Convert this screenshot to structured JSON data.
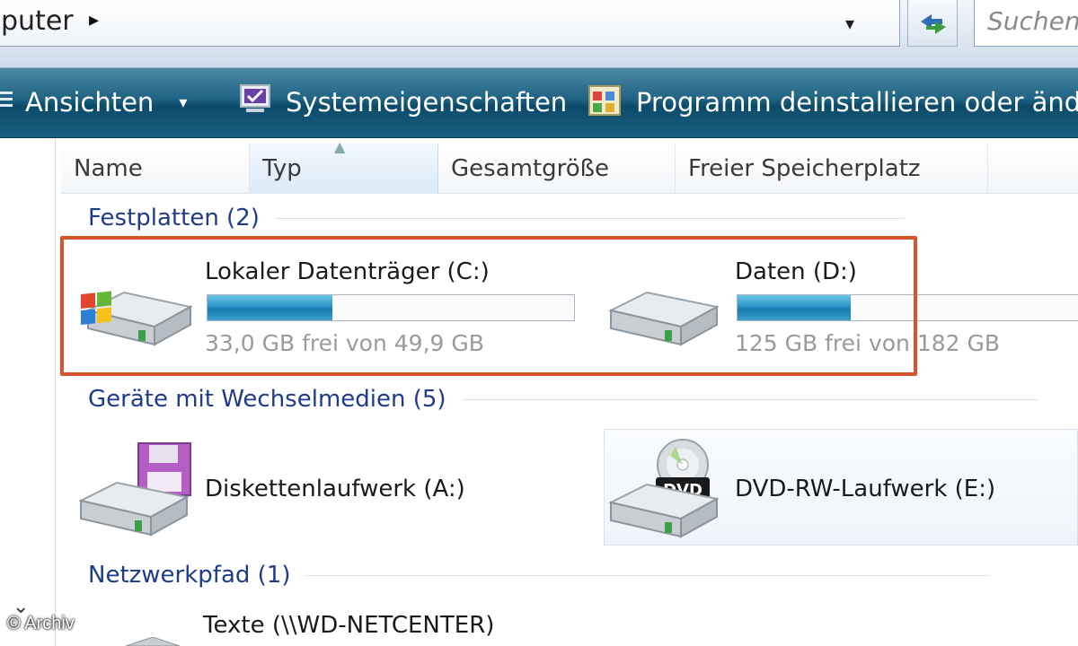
{
  "address_bar": {
    "path_text": "puter",
    "chevron": "▸",
    "dropdown": "▾",
    "search_placeholder": "Suchen"
  },
  "toolbar": {
    "views_label": "Ansichten",
    "views_dropdown": "▾",
    "system_properties_label": "Systemeigenschaften",
    "uninstall_label": "Programm deinstallieren oder ände"
  },
  "columns": {
    "name": "Name",
    "type": "Typ",
    "total_size": "Gesamtgröße",
    "free_space": "Freier Speicherplatz"
  },
  "groups": {
    "hard_disks": {
      "title": "Festplatten (2)",
      "items": [
        {
          "label": "Lokaler Datenträger (C:)",
          "free_text": "33,0 GB frei von 49,9 GB",
          "used_fraction": 0.34
        },
        {
          "label": "Daten (D:)",
          "free_text": "125 GB frei von 182 GB",
          "used_fraction": 0.31
        }
      ]
    },
    "removable": {
      "title": "Geräte mit Wechselmedien (5)",
      "items": [
        {
          "label": "Diskettenlaufwerk (A:)"
        },
        {
          "label": "DVD-RW-Laufwerk (E:)",
          "badge": "DVD"
        }
      ]
    },
    "network": {
      "title": "Netzwerkpfad (1)",
      "items": [
        {
          "label": "Texte (\\\\WD-NETCENTER)"
        }
      ]
    }
  },
  "nav": {
    "expand_glyph": "⌄"
  },
  "watermark": "© Archiv",
  "colors": {
    "highlight_border": "#d8532a",
    "group_title": "#1f3c8a",
    "toolbar_bg": "#1f6282",
    "bar_fill": "#2b95c6"
  }
}
